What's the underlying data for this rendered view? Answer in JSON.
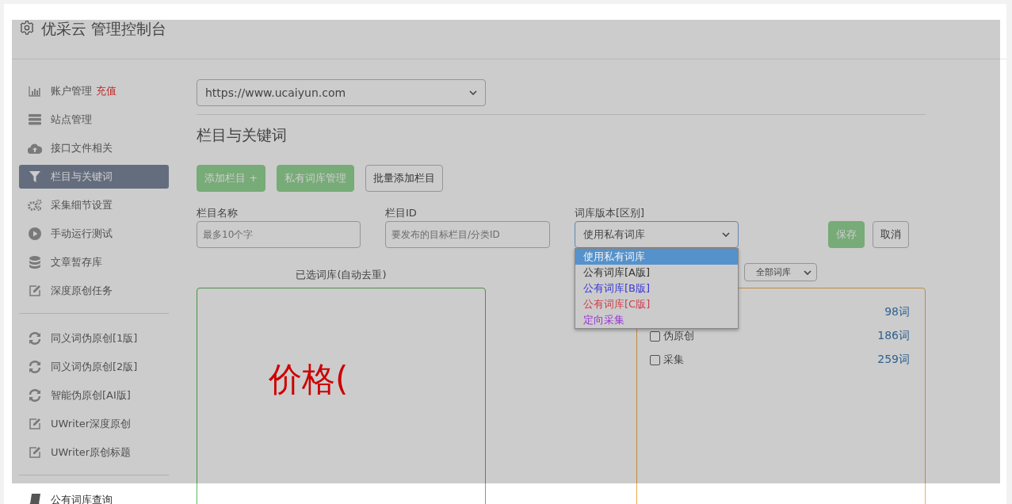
{
  "header": {
    "title": "优采云 管理控制台"
  },
  "sidebar": {
    "groups": [
      {
        "items": [
          {
            "label": "账户管理",
            "badge": "充值",
            "selected": false
          },
          {
            "label": "站点管理",
            "selected": false
          },
          {
            "label": "接口文件相关",
            "selected": false
          },
          {
            "label": "栏目与关键词",
            "selected": true
          },
          {
            "label": "采集细节设置",
            "selected": false
          },
          {
            "label": "手动运行测试",
            "selected": false
          },
          {
            "label": "文章暂存库",
            "selected": false
          },
          {
            "label": "深度原创任务",
            "selected": false
          }
        ]
      },
      {
        "items": [
          {
            "label": "同义词伪原创[1版]",
            "selected": false
          },
          {
            "label": "同义词伪原创[2版]",
            "selected": false
          },
          {
            "label": "智能伪原创[AI版]",
            "selected": false
          },
          {
            "label": "UWriter深度原创",
            "selected": false
          },
          {
            "label": "UWriter原创标题",
            "selected": false
          }
        ]
      },
      {
        "items": [
          {
            "label": "公有词库查询",
            "selected": false
          }
        ]
      }
    ]
  },
  "site_select": {
    "value": "https://www.ucaiyun.com"
  },
  "section_title": "栏目与关键词",
  "actions": [
    {
      "label": "添加栏目 +",
      "kind": "primary"
    },
    {
      "label": "私有词库管理",
      "kind": "primary"
    },
    {
      "label": "批量添加栏目",
      "kind": "default"
    }
  ],
  "form": {
    "fields": [
      {
        "kind": "input",
        "label": "栏目名称",
        "placeholder": "最多10个字"
      },
      {
        "kind": "input",
        "label": "栏目ID",
        "placeholder": "要发布的目标栏目/分类ID"
      },
      {
        "kind": "select",
        "label": "词库版本[区别]",
        "value": "使用私有词库"
      }
    ],
    "save": "保存",
    "cancel": "取消"
  },
  "dropdown": {
    "expanded": true,
    "options": [
      {
        "label": "使用私有词库",
        "selected": true
      },
      {
        "label": "公有词库[A版]",
        "selected": false,
        "color": "#333333"
      },
      {
        "label": "公有词库[B版]",
        "selected": false,
        "color": "#3a36d6"
      },
      {
        "label": "公有词库[C版]",
        "selected": false,
        "color": "#d03b4a"
      },
      {
        "label": "定向采集",
        "selected": false,
        "color": "#9a32d8"
      }
    ]
  },
  "selected_panel": {
    "title": "已选词库(自动去重)",
    "text": "价格("
  },
  "library_panel": {
    "filter": "全部词库",
    "items": [
      {
        "count": "98词"
      },
      {
        "label": "伪原创",
        "checked": false,
        "count": "186词"
      },
      {
        "label": "采集",
        "checked": false,
        "count": "259词"
      }
    ]
  }
}
